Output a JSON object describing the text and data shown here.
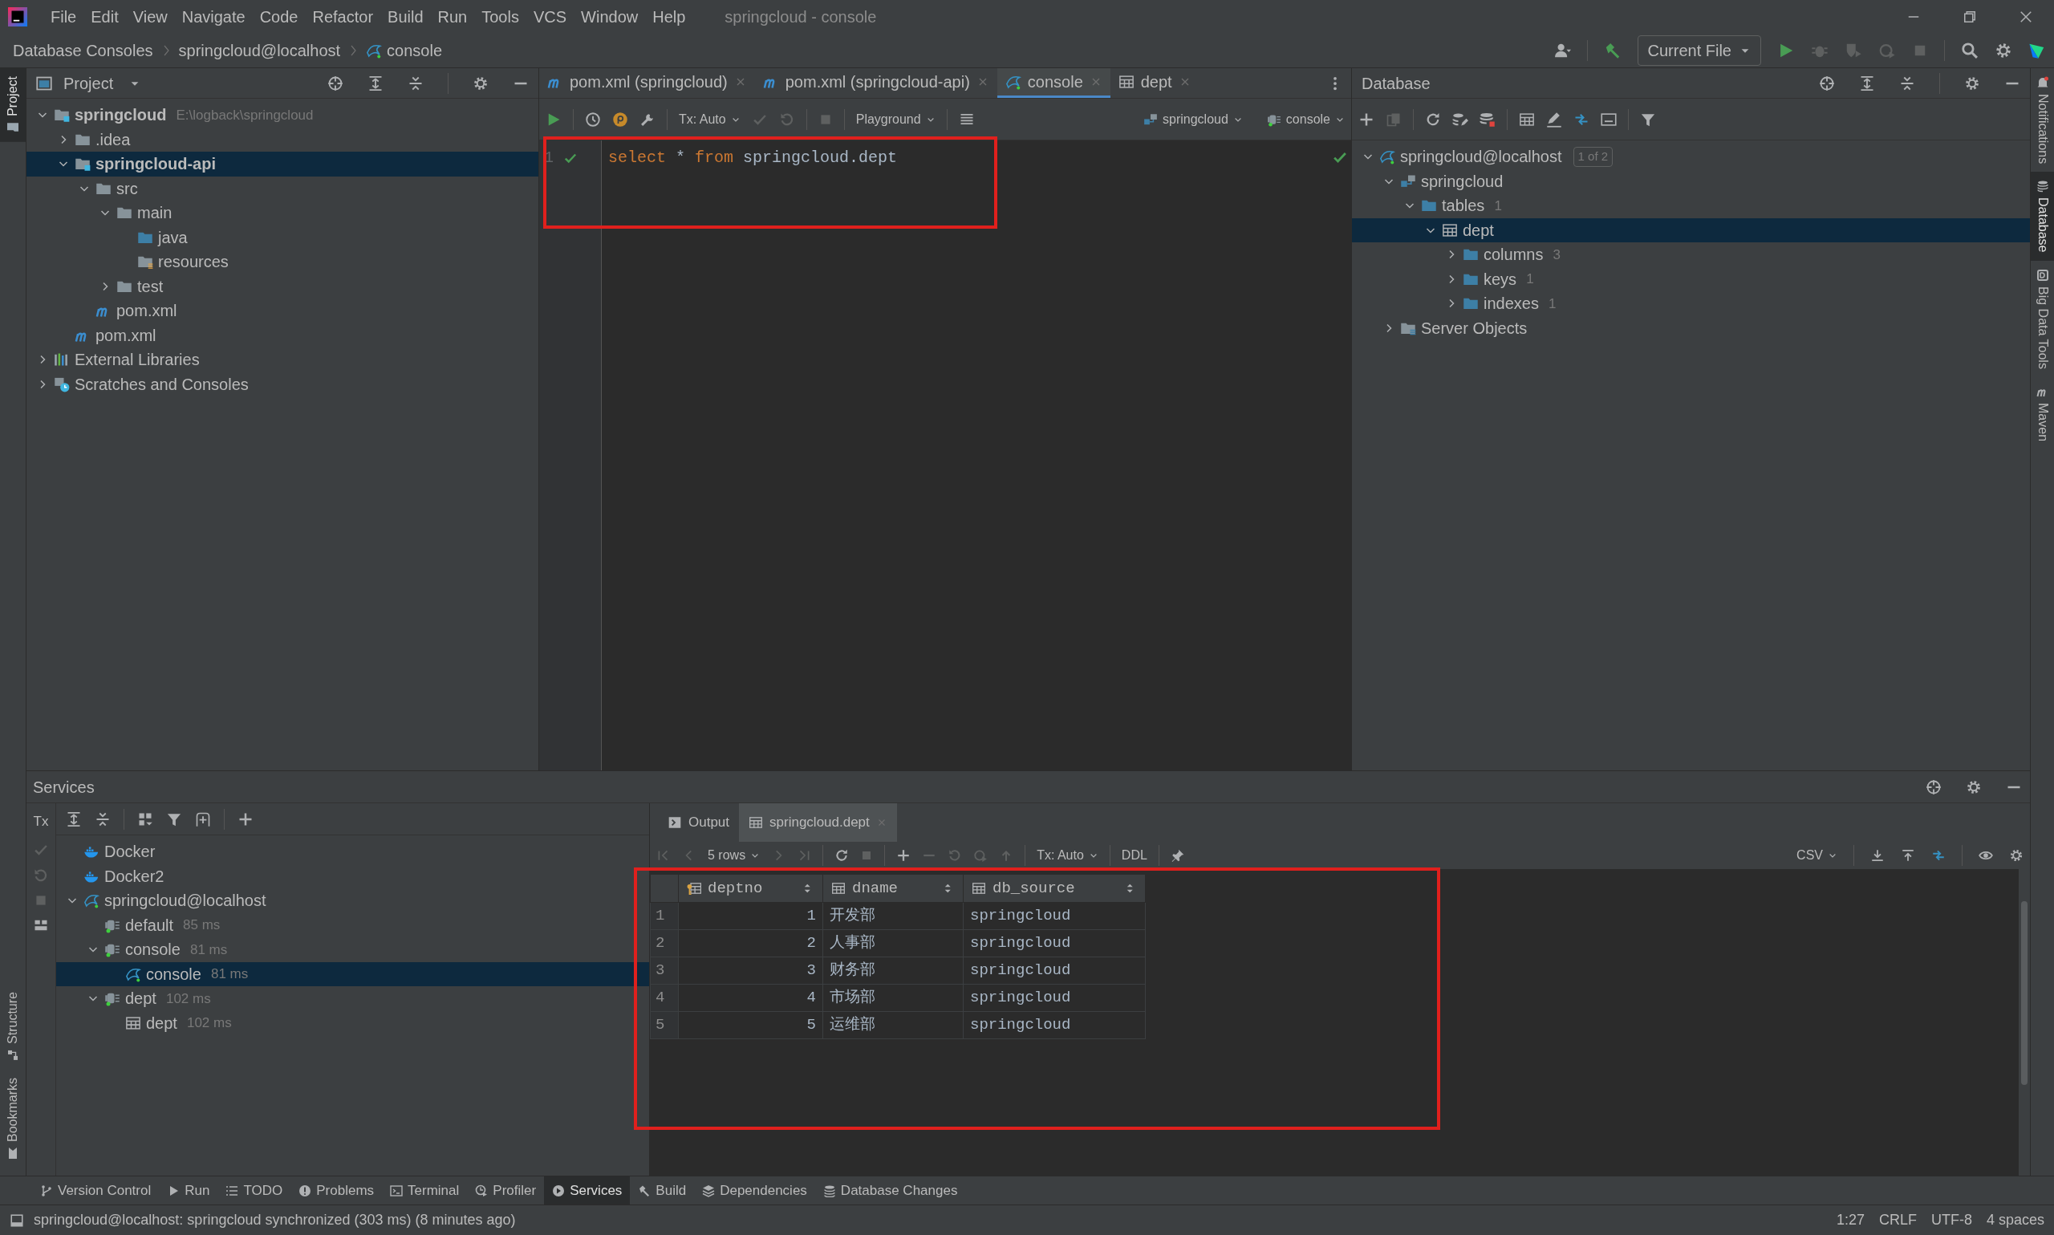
{
  "menu": [
    "File",
    "Edit",
    "View",
    "Navigate",
    "Code",
    "Refactor",
    "Build",
    "Run",
    "Tools",
    "VCS",
    "Window",
    "Help"
  ],
  "window_title": "springcloud - console",
  "breadcrumbs": [
    {
      "label": "Database Consoles"
    },
    {
      "label": "springcloud@localhost"
    },
    {
      "label": "console"
    }
  ],
  "run_config": "Current File",
  "left_tabs": [
    {
      "label": "Project",
      "selected": true
    }
  ],
  "left_bottom_tabs": [
    {
      "label": "Structure",
      "selected": false
    },
    {
      "label": "Bookmarks",
      "selected": false
    }
  ],
  "right_tabs": [
    {
      "label": "Notifications",
      "selected": false
    },
    {
      "label": "Database",
      "selected": true
    },
    {
      "label": "Big Data Tools",
      "selected": false
    },
    {
      "label": "Maven",
      "selected": false
    }
  ],
  "project": {
    "title": "Project",
    "tree": [
      {
        "label": "springcloud",
        "hint": "E:\\logback\\springcloud",
        "kind": "module",
        "expanded": true,
        "selected": false,
        "children": [
          {
            "label": ".idea",
            "kind": "folder",
            "expanded": false,
            "selected": false
          },
          {
            "label": "springcloud-api",
            "kind": "module",
            "expanded": true,
            "selected": true,
            "children": [
              {
                "label": "src",
                "kind": "folder",
                "expanded": true,
                "selected": false,
                "children": [
                  {
                    "label": "main",
                    "kind": "folder",
                    "expanded": true,
                    "selected": false,
                    "children": [
                      {
                        "label": "java",
                        "kind": "source",
                        "selected": false
                      },
                      {
                        "label": "resources",
                        "kind": "resources",
                        "selected": false
                      }
                    ]
                  },
                  {
                    "label": "test",
                    "kind": "folder",
                    "expanded": false,
                    "selected": false
                  }
                ]
              },
              {
                "label": "pom.xml",
                "kind": "maven",
                "selected": false
              }
            ]
          },
          {
            "label": "pom.xml",
            "kind": "maven",
            "selected": false
          }
        ]
      },
      {
        "label": "External Libraries",
        "kind": "libraries",
        "expanded": false,
        "selected": false
      },
      {
        "label": "Scratches and Consoles",
        "kind": "scratches",
        "expanded": false,
        "selected": false
      }
    ]
  },
  "editor": {
    "tabs": [
      {
        "label": "pom.xml (springcloud)",
        "kind": "maven",
        "selected": false
      },
      {
        "label": "pom.xml (springcloud-api)",
        "kind": "maven",
        "selected": false
      },
      {
        "label": "console",
        "kind": "datasource",
        "selected": true
      },
      {
        "label": "dept",
        "kind": "table",
        "selected": false
      }
    ],
    "toolbar": {
      "tx": "Tx: Auto",
      "playground": "Playground",
      "schema": "springcloud",
      "session": "console"
    },
    "lines": [
      {
        "number": "1",
        "tokens": [
          {
            "text": "select",
            "kind": "keyword"
          },
          {
            "text": " * ",
            "kind": "plain"
          },
          {
            "text": "from",
            "kind": "keyword"
          },
          {
            "text": " springcloud.dept",
            "kind": "plain"
          }
        ]
      }
    ]
  },
  "database": {
    "title": "Database",
    "tree": [
      {
        "label": "springcloud@localhost",
        "badge": "1 of 2",
        "kind": "datasource",
        "expanded": true,
        "selected": false,
        "children": [
          {
            "label": "springcloud",
            "kind": "schema",
            "expanded": true,
            "selected": false,
            "children": [
              {
                "label": "tables",
                "hint": "1",
                "kind": "dbfolder",
                "expanded": true,
                "selected": false,
                "children": [
                  {
                    "label": "dept",
                    "kind": "table",
                    "expanded": true,
                    "selected": true,
                    "children": [
                      {
                        "label": "columns",
                        "hint": "3",
                        "kind": "dbfolder",
                        "expanded": false,
                        "selected": false
                      },
                      {
                        "label": "keys",
                        "hint": "1",
                        "kind": "dbfolder",
                        "expanded": false,
                        "selected": false
                      },
                      {
                        "label": "indexes",
                        "hint": "1",
                        "kind": "dbfolder",
                        "expanded": false,
                        "selected": false
                      }
                    ]
                  }
                ]
              }
            ]
          },
          {
            "label": "Server Objects",
            "kind": "server",
            "expanded": false,
            "selected": false
          }
        ]
      }
    ]
  },
  "services": {
    "title": "Services",
    "tx_label": "Tx",
    "tree": [
      {
        "label": "Docker",
        "kind": "docker",
        "selected": false
      },
      {
        "label": "Docker2",
        "kind": "docker",
        "selected": false
      },
      {
        "label": "springcloud@localhost",
        "kind": "datasource",
        "expanded": true,
        "selected": false,
        "children": [
          {
            "label": "default",
            "hint": "85 ms",
            "kind": "session",
            "selected": false
          },
          {
            "label": "console",
            "hint": "81 ms",
            "kind": "session",
            "expanded": true,
            "selected": false,
            "children": [
              {
                "label": "console",
                "hint": "81 ms",
                "kind": "datasource",
                "selected": true
              }
            ]
          },
          {
            "label": "dept",
            "hint": "102 ms",
            "kind": "session",
            "expanded": true,
            "selected": false,
            "children": [
              {
                "label": "dept",
                "hint": "102 ms",
                "kind": "table",
                "selected": false
              }
            ]
          }
        ]
      }
    ],
    "result_tabs": [
      {
        "label": "Output",
        "kind": "output",
        "selected": false
      },
      {
        "label": "springcloud.dept",
        "kind": "table",
        "selected": true
      }
    ],
    "grid_toolbar": {
      "rows": "5 rows",
      "tx": "Tx: Auto",
      "ddl": "DDL",
      "export": "CSV"
    },
    "table": {
      "columns": [
        {
          "label": "deptno",
          "kind": "key"
        },
        {
          "label": "dname",
          "kind": "column"
        },
        {
          "label": "db_source",
          "kind": "column"
        }
      ],
      "rows": [
        {
          "number": "1",
          "cells": [
            "1",
            "开发部",
            "springcloud"
          ]
        },
        {
          "number": "2",
          "cells": [
            "2",
            "人事部",
            "springcloud"
          ]
        },
        {
          "number": "3",
          "cells": [
            "3",
            "财务部",
            "springcloud"
          ]
        },
        {
          "number": "4",
          "cells": [
            "4",
            "市场部",
            "springcloud"
          ]
        },
        {
          "number": "5",
          "cells": [
            "5",
            "运维部",
            "springcloud"
          ]
        }
      ]
    }
  },
  "tool_windows": [
    {
      "label": "Version Control",
      "selected": false
    },
    {
      "label": "Run",
      "selected": false
    },
    {
      "label": "TODO",
      "selected": false
    },
    {
      "label": "Problems",
      "selected": false
    },
    {
      "label": "Terminal",
      "selected": false
    },
    {
      "label": "Profiler",
      "selected": false
    },
    {
      "label": "Services",
      "selected": true
    },
    {
      "label": "Build",
      "selected": false
    },
    {
      "label": "Dependencies",
      "selected": false
    },
    {
      "label": "Database Changes",
      "selected": false
    }
  ],
  "status": {
    "message": "springcloud@localhost: springcloud synchronized (303 ms) (8 minutes ago)",
    "items": [
      "1:27",
      "CRLF",
      "UTF-8",
      "4 spaces"
    ]
  }
}
